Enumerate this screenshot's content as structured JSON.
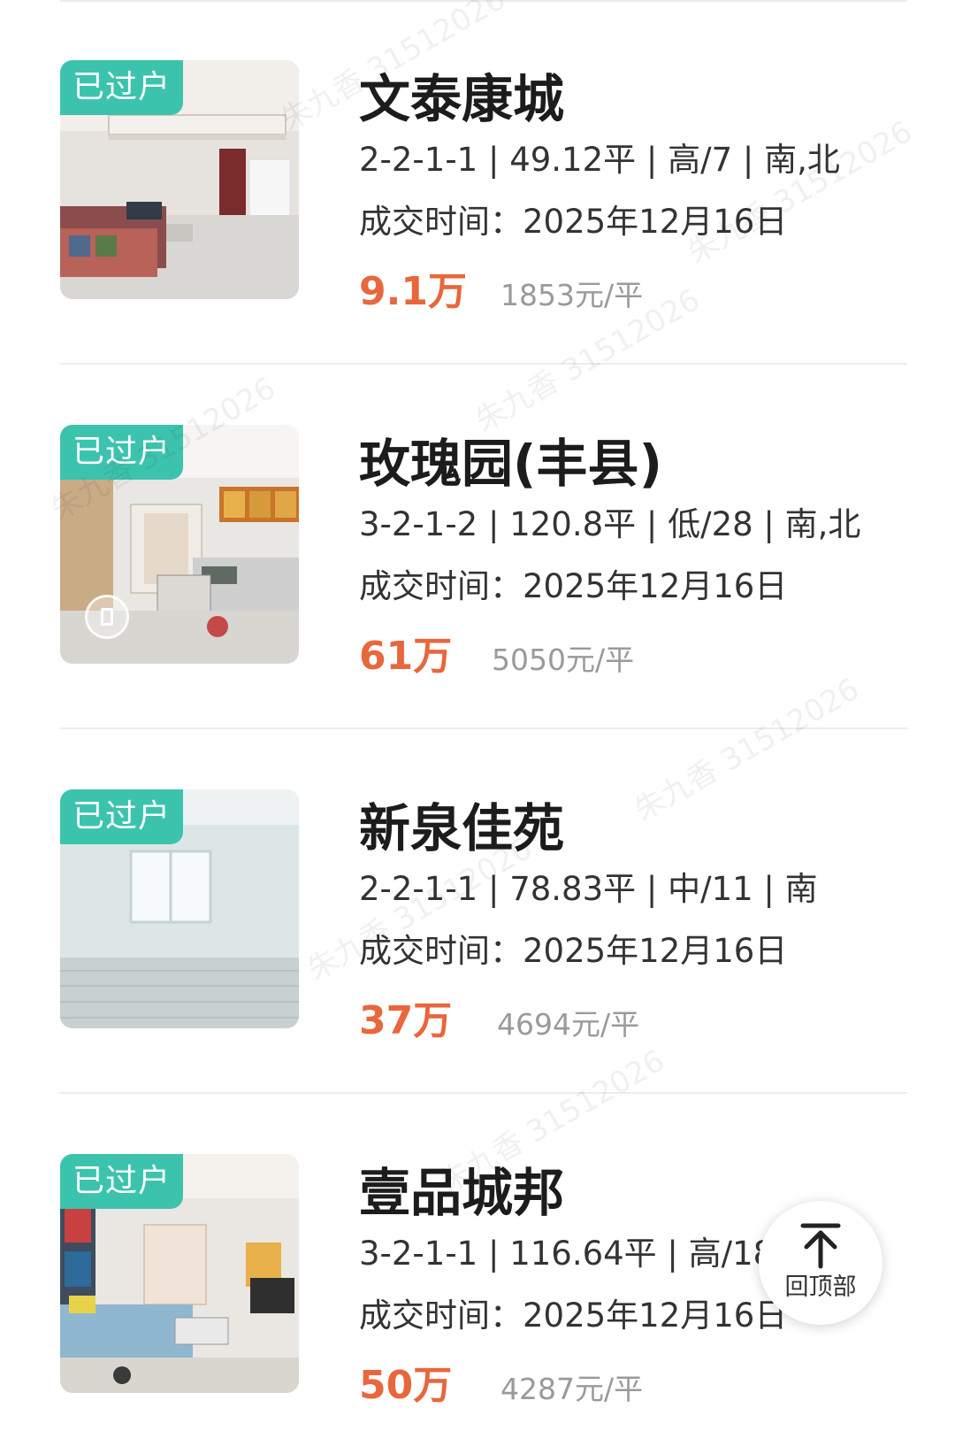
{
  "listings": [
    {
      "badge": "已过户",
      "name": "文泰康城",
      "specs": "2-2-1-1 | 49.12平 | 高/7 | 南,北",
      "deal_time": "成交时间：2025年12月16日",
      "price": "9.1万",
      "unit_price": "1853元/平",
      "has_vr": false
    },
    {
      "badge": "已过户",
      "name": "玫瑰园(丰县)",
      "specs": "3-2-1-2 | 120.8平 | 低/28 | 南,北",
      "deal_time": "成交时间：2025年12月16日",
      "price": "61万",
      "unit_price": "5050元/平",
      "has_vr": true
    },
    {
      "badge": "已过户",
      "name": "新泉佳苑",
      "specs": "2-2-1-1 | 78.83平 | 中/11 | 南",
      "deal_time": "成交时间：2025年12月16日",
      "price": "37万",
      "unit_price": "4694元/平",
      "has_vr": false
    },
    {
      "badge": "已过户",
      "name": "壹品城邦",
      "specs": "3-2-1-1 | 116.64平 | 高/18",
      "deal_time": "成交时间：2025年12月16日",
      "price": "50万",
      "unit_price": "4287元/平",
      "has_vr": false
    }
  ],
  "back_to_top": {
    "label": "回顶部",
    "icon": "arrow-up-to-top-icon"
  },
  "watermark": {
    "text": "朱九香 31512026"
  },
  "colors": {
    "badge": "#3cc3ae",
    "price": "#e8673c",
    "unit_price": "#9a9a9a",
    "title": "#1c1c1c"
  }
}
